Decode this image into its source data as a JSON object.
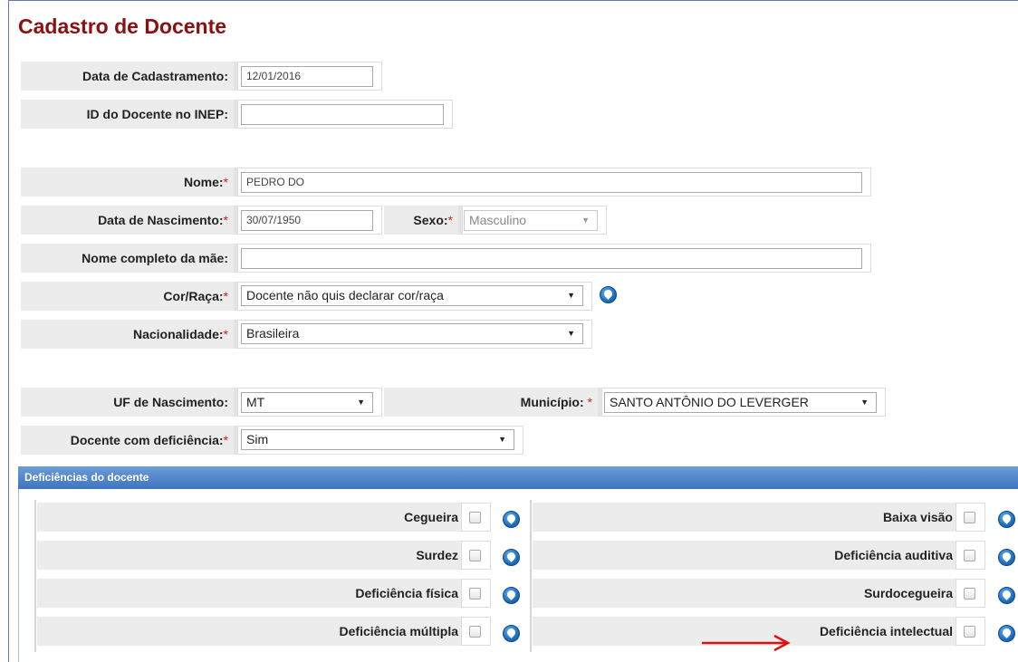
{
  "page_title": "Cadastro de Docente",
  "form": {
    "data_cadastramento": {
      "label": "Data de Cadastramento:",
      "value": "12/01/2016"
    },
    "id_inep": {
      "label": "ID do Docente no INEP:",
      "value": ""
    },
    "nome": {
      "label": "Nome:",
      "required": "*",
      "value": "PEDRO DO"
    },
    "data_nascimento": {
      "label": "Data de Nascimento:",
      "required": "*",
      "value": "30/07/1950"
    },
    "sexo": {
      "label": "Sexo:",
      "required": "*",
      "value": "Masculino"
    },
    "nome_mae": {
      "label": "Nome completo da mãe:",
      "value": ""
    },
    "cor_raca": {
      "label": "Cor/Raça:",
      "required": "*",
      "value": "Docente não quis declarar cor/raça"
    },
    "nacionalidade": {
      "label": "Nacionalidade:",
      "required": "*",
      "value": "Brasileira"
    },
    "uf_nascimento": {
      "label": "UF de Nascimento:",
      "value": "MT"
    },
    "municipio": {
      "label": "Município:",
      "required": "*",
      "value": "SANTO ANTÔNIO DO LEVERGER"
    },
    "deficiencia": {
      "label": "Docente com deficiência:",
      "required": "*",
      "value": "Sim"
    }
  },
  "deficiencias_panel": {
    "title": "Deficiências do docente",
    "left": [
      {
        "label": "Cegueira",
        "checked": false
      },
      {
        "label": "Surdez",
        "checked": false
      },
      {
        "label": "Deficiência física",
        "checked": false
      },
      {
        "label": "Deficiência múltipla",
        "checked": false
      }
    ],
    "right": [
      {
        "label": "Baixa visão",
        "checked": false
      },
      {
        "label": "Deficiência auditiva",
        "checked": false
      },
      {
        "label": "Surdocegueira",
        "checked": false
      },
      {
        "label": "Deficiência intelectual",
        "checked": false
      }
    ]
  },
  "icons": {
    "help": "help-icon",
    "dropdown": "dropdown-arrow-icon",
    "annotation": "red-arrow-icon"
  },
  "colors": {
    "title": "#8b1010",
    "panel_header": "#4f83c8",
    "required": "#d02020",
    "annotation_arrow": "#e01010"
  }
}
